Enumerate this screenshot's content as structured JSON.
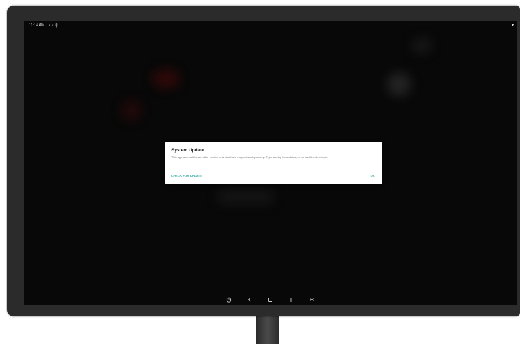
{
  "status_bar": {
    "time": "11:14 AM",
    "left_icons": [
      "notification-icon",
      "notification-icon",
      "usb-icon"
    ],
    "right_icon": "wifi-icon"
  },
  "dialog": {
    "title": "System Update",
    "message": "This app was built for an older version of Android and may not work properly. Try checking for updates, or contact the developer.",
    "check_button": "CHECK FOR UPDATE",
    "ok_button": "OK",
    "accent_color": "#26a69a"
  },
  "nav_bar": {
    "buttons": [
      "power-icon",
      "back-icon",
      "home-icon",
      "recents-icon",
      "screenshot-icon"
    ]
  }
}
